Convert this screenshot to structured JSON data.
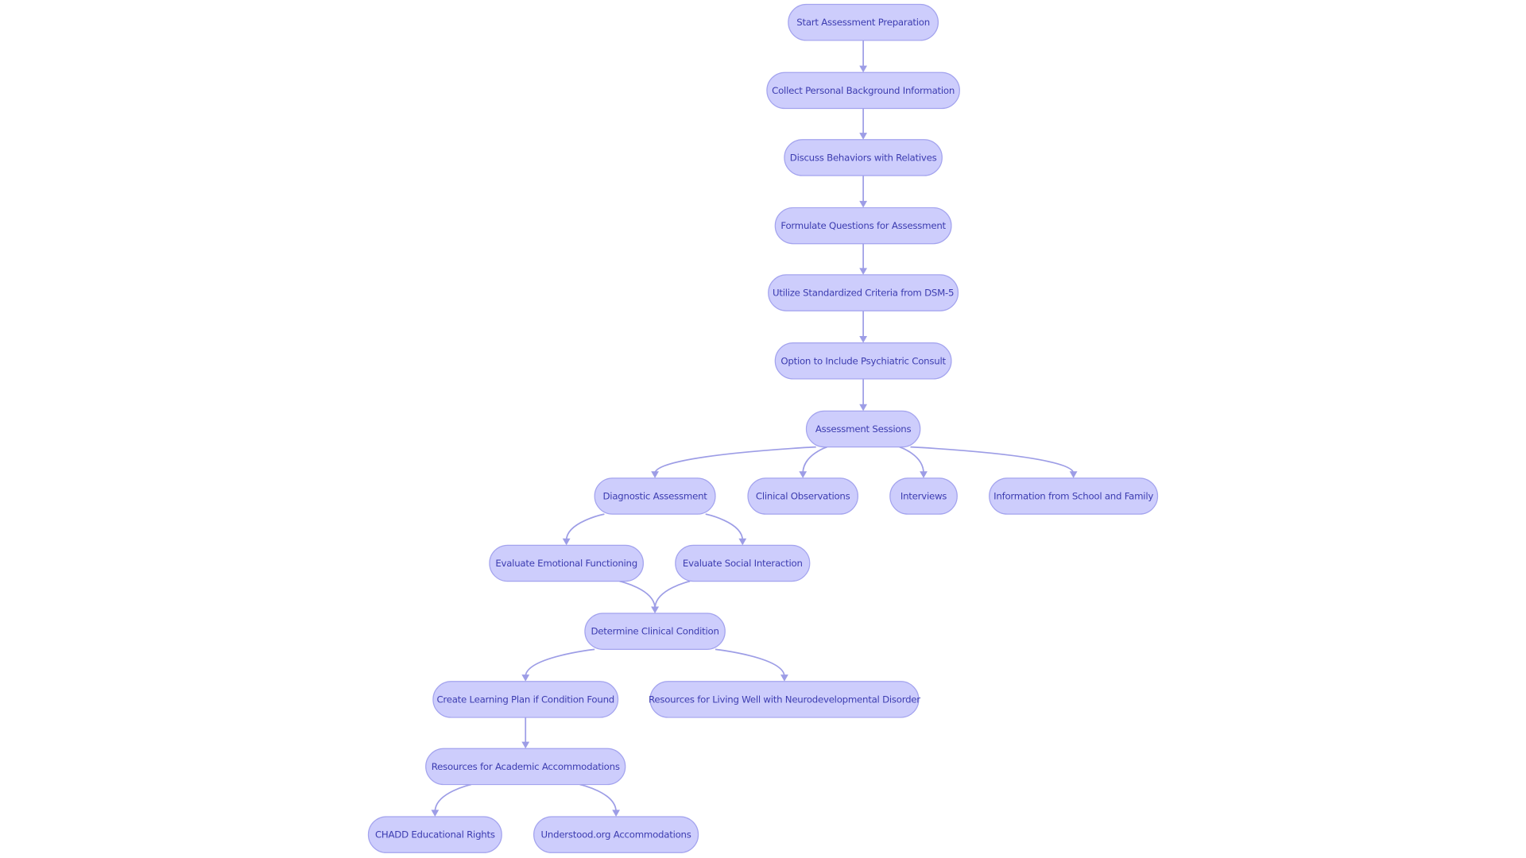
{
  "diagram": {
    "type": "flowchart",
    "colors": {
      "node_fill": "#cdcdfc",
      "node_stroke": "#a3a3ee",
      "text": "#3c3cb0",
      "edge": "#9d9de6"
    },
    "nodes": [
      {
        "id": "start",
        "label": "Start Assessment Preparation"
      },
      {
        "id": "collect",
        "label": "Collect Personal Background Information"
      },
      {
        "id": "discuss",
        "label": "Discuss Behaviors with Relatives"
      },
      {
        "id": "formulate",
        "label": "Formulate Questions for Assessment"
      },
      {
        "id": "utilize",
        "label": "Utilize Standardized Criteria from DSM-5"
      },
      {
        "id": "option",
        "label": "Option to Include Psychiatric Consult"
      },
      {
        "id": "sessions",
        "label": "Assessment Sessions"
      },
      {
        "id": "diagnostic",
        "label": "Diagnostic Assessment"
      },
      {
        "id": "clinical",
        "label": "Clinical Observations"
      },
      {
        "id": "interviews",
        "label": "Interviews"
      },
      {
        "id": "information",
        "label": "Information from School and Family"
      },
      {
        "id": "emotional",
        "label": "Evaluate Emotional Functioning"
      },
      {
        "id": "social",
        "label": "Evaluate Social Interaction"
      },
      {
        "id": "determine",
        "label": "Determine Clinical Condition"
      },
      {
        "id": "create",
        "label": "Create Learning Plan if Condition Found"
      },
      {
        "id": "living",
        "label": "Resources for Living Well with Neurodevelopmental Disorder"
      },
      {
        "id": "academic",
        "label": "Resources for Academic Accommodations"
      },
      {
        "id": "chadd",
        "label": "CHADD Educational Rights"
      },
      {
        "id": "understood",
        "label": "Understood.org Accommodations"
      }
    ],
    "edges": [
      [
        "start",
        "collect"
      ],
      [
        "collect",
        "discuss"
      ],
      [
        "discuss",
        "formulate"
      ],
      [
        "formulate",
        "utilize"
      ],
      [
        "utilize",
        "option"
      ],
      [
        "option",
        "sessions"
      ],
      [
        "sessions",
        "diagnostic"
      ],
      [
        "sessions",
        "clinical"
      ],
      [
        "sessions",
        "interviews"
      ],
      [
        "sessions",
        "information"
      ],
      [
        "diagnostic",
        "emotional"
      ],
      [
        "diagnostic",
        "social"
      ],
      [
        "emotional",
        "determine"
      ],
      [
        "social",
        "determine"
      ],
      [
        "determine",
        "create"
      ],
      [
        "determine",
        "living"
      ],
      [
        "create",
        "academic"
      ],
      [
        "academic",
        "chadd"
      ],
      [
        "academic",
        "understood"
      ]
    ]
  }
}
